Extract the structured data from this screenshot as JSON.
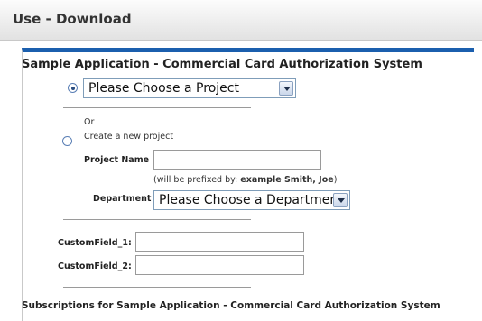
{
  "header": {
    "title": "Use - Download"
  },
  "form": {
    "app_title": "Sample Application - Commercial Card Authorization System",
    "project_select": {
      "value": "Please Choose a Project"
    },
    "or_label": "Or",
    "create_new_label": "Create a new project",
    "project_name_label": "Project Name",
    "project_name_value": "",
    "prefix_note_text": "(will be prefixed by: ",
    "prefix_note_example": "example Smith, Joe",
    "prefix_note_close": ")",
    "department_label": "Department",
    "department_select": {
      "value": "Please Choose a Department"
    },
    "custom_field_1_label": "CustomField_1:",
    "custom_field_1_value": "",
    "custom_field_2_label": "CustomField_2:",
    "custom_field_2_value": ""
  },
  "subscriptions": {
    "heading": "Subscriptions for Sample Application - Commercial Card Authorization System"
  },
  "colors": {
    "accent": "#1b5fae"
  }
}
